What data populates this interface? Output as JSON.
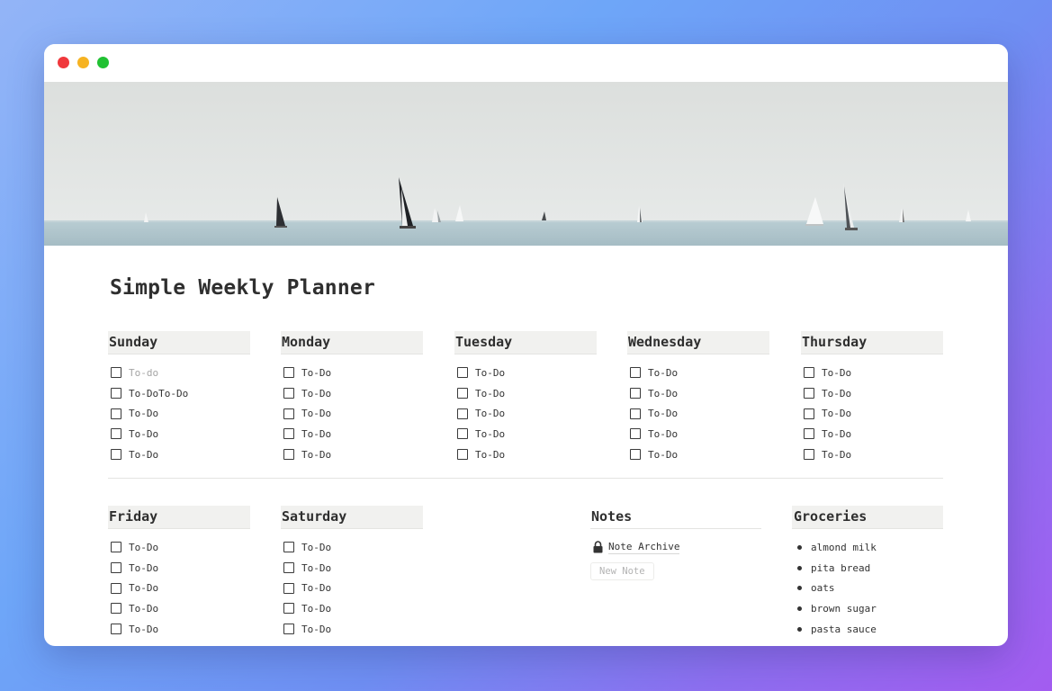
{
  "page": {
    "title": "Simple Weekly Planner"
  },
  "days_top": [
    {
      "name": "Sunday",
      "items": [
        {
          "text": "To-do",
          "placeholder": true
        },
        {
          "text": "To-DoTo-Do"
        },
        {
          "text": "To-Do"
        },
        {
          "text": "To-Do"
        },
        {
          "text": "To-Do"
        }
      ]
    },
    {
      "name": "Monday",
      "items": [
        {
          "text": "To-Do"
        },
        {
          "text": "To-Do"
        },
        {
          "text": "To-Do"
        },
        {
          "text": "To-Do"
        },
        {
          "text": "To-Do"
        }
      ]
    },
    {
      "name": "Tuesday",
      "items": [
        {
          "text": "To-Do"
        },
        {
          "text": "To-Do"
        },
        {
          "text": "To-Do"
        },
        {
          "text": "To-Do"
        },
        {
          "text": "To-Do"
        }
      ]
    },
    {
      "name": "Wednesday",
      "items": [
        {
          "text": "To-Do"
        },
        {
          "text": "To-Do"
        },
        {
          "text": "To-Do"
        },
        {
          "text": "To-Do"
        },
        {
          "text": "To-Do"
        }
      ]
    },
    {
      "name": "Thursday",
      "items": [
        {
          "text": "To-Do"
        },
        {
          "text": "To-Do"
        },
        {
          "text": "To-Do"
        },
        {
          "text": "To-Do"
        },
        {
          "text": "To-Do"
        }
      ]
    }
  ],
  "days_bottom": [
    {
      "name": "Friday",
      "items": [
        {
          "text": "To-Do"
        },
        {
          "text": "To-Do"
        },
        {
          "text": "To-Do"
        },
        {
          "text": "To-Do"
        },
        {
          "text": "To-Do"
        }
      ]
    },
    {
      "name": "Saturday",
      "items": [
        {
          "text": "To-Do"
        },
        {
          "text": "To-Do"
        },
        {
          "text": "To-Do"
        },
        {
          "text": "To-Do"
        },
        {
          "text": "To-Do"
        }
      ]
    }
  ],
  "notes": {
    "title": "Notes",
    "archive_label": "Note Archive",
    "archive_icon": "lock-icon",
    "new_note_label": "New Note"
  },
  "groceries": {
    "title": "Groceries",
    "items": [
      "almond milk",
      "pita bread",
      "oats",
      "brown sugar",
      "pasta sauce"
    ]
  },
  "colors": {
    "header_bg": "#f1f1ef",
    "text": "#2f2f2f",
    "placeholder": "#a5a5a5",
    "traffic_red": "#f0383c",
    "traffic_yellow": "#f6b322",
    "traffic_green": "#21c133"
  }
}
